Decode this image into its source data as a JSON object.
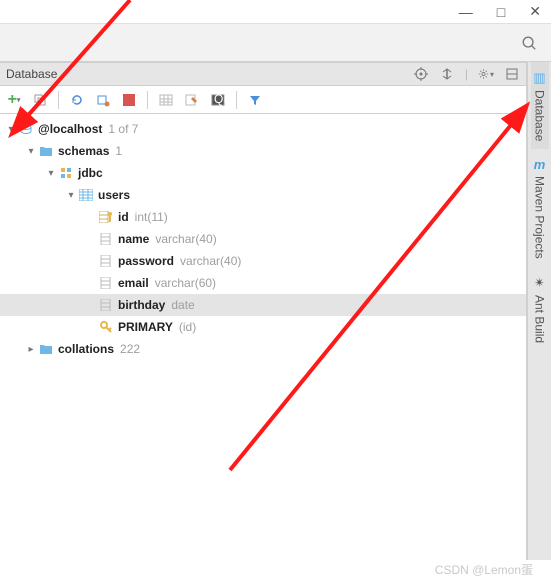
{
  "window": {
    "min": "—",
    "max": "□",
    "close": "✕"
  },
  "panel": {
    "title": "Database",
    "counter": "1 of 7"
  },
  "sidetabs": {
    "database": "Database",
    "maven": "Maven Projects",
    "ant": "Ant Build"
  },
  "tree": {
    "connection": "@localhost",
    "schemas": {
      "label": "schemas",
      "count": "1"
    },
    "db": "jdbc",
    "table": "users",
    "columns": [
      {
        "name": "id",
        "type": "int(11)",
        "pk": true
      },
      {
        "name": "name",
        "type": "varchar(40)",
        "pk": false
      },
      {
        "name": "password",
        "type": "varchar(40)",
        "pk": false
      },
      {
        "name": "email",
        "type": "varchar(60)",
        "pk": false
      },
      {
        "name": "birthday",
        "type": "date",
        "pk": false
      }
    ],
    "primary": {
      "label": "PRIMARY",
      "cols": "(id)"
    },
    "collations": {
      "label": "collations",
      "count": "222"
    }
  },
  "watermark": "CSDN @Lemon蛋"
}
